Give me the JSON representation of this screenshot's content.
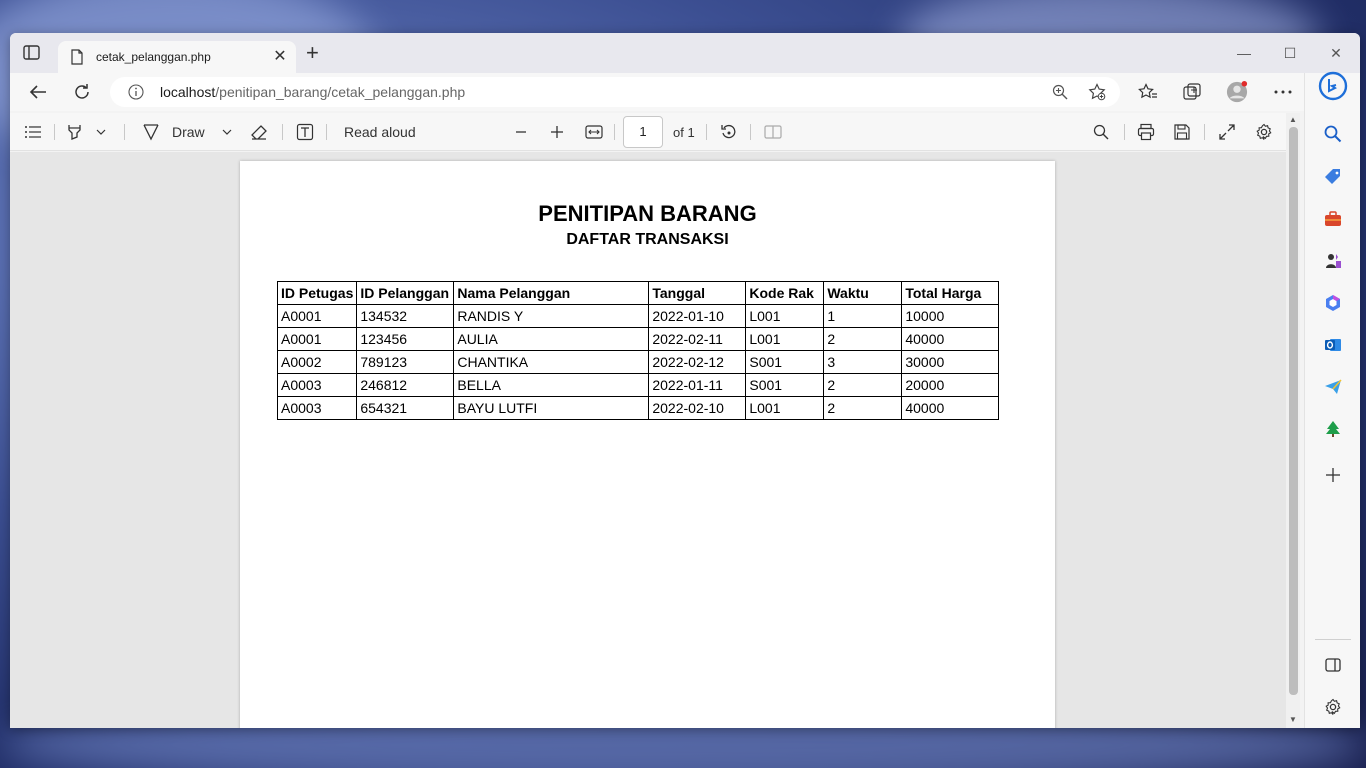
{
  "browser": {
    "tab": {
      "title": "cetak_pelanggan.php",
      "close_glyph": "✕"
    },
    "new_tab_glyph": "+",
    "window_controls": {
      "minimize": "—",
      "maximize": "☐",
      "close": "✕"
    },
    "url": {
      "host": "localhost",
      "path": "/penitipan_barang/cetak_pelanggan.php"
    }
  },
  "pdf_toolbar": {
    "draw_label": "Draw",
    "read_aloud_label": "Read aloud",
    "page_current": "1",
    "page_total": "of 1"
  },
  "document": {
    "title": "PENITIPAN BARANG",
    "subtitle": "DAFTAR TRANSAKSI",
    "table": {
      "headers": [
        "ID Petugas",
        "ID Pelanggan",
        "Nama Pelanggan",
        "Tanggal",
        "Kode Rak",
        "Waktu",
        "Total Harga"
      ],
      "rows": [
        [
          "A0001",
          "134532",
          "RANDIS Y",
          "2022-01-10",
          "L001",
          "1",
          "10000"
        ],
        [
          "A0001",
          "123456",
          "AULIA",
          "2022-02-11",
          "L001",
          "2",
          "40000"
        ],
        [
          "A0002",
          "789123",
          "CHANTIKA",
          "2022-02-12",
          "S001",
          "3",
          "30000"
        ],
        [
          "A0003",
          "246812",
          "BELLA",
          "2022-01-11",
          "S001",
          "2",
          "20000"
        ],
        [
          "A0003",
          "654321",
          "BAYU LUTFI",
          "2022-02-10",
          "L001",
          "2",
          "40000"
        ]
      ]
    }
  },
  "colors": {
    "accent": "#0f6cbd",
    "sidebar_bing": "#1e6fd9"
  }
}
